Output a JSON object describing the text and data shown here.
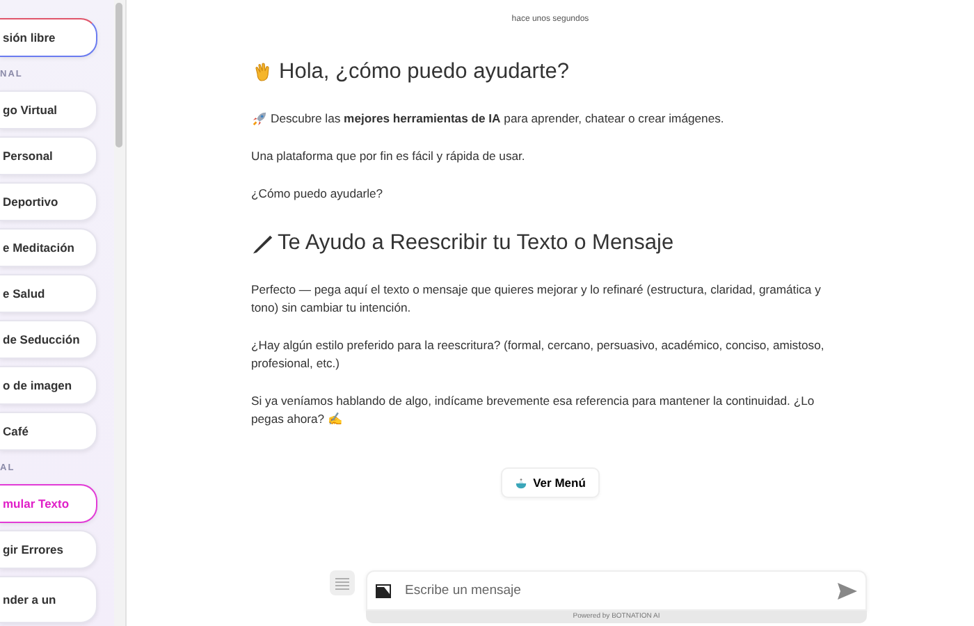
{
  "sidebar": {
    "items": [
      {
        "kind": "featured",
        "label": "sión libre",
        "selected": false
      },
      {
        "kind": "heading",
        "label": "NAL"
      },
      {
        "kind": "button",
        "label": "go Virtual",
        "selected": false
      },
      {
        "kind": "button",
        "label": "Personal",
        "selected": false
      },
      {
        "kind": "button",
        "label": "Deportivo",
        "selected": false
      },
      {
        "kind": "button",
        "label": "e Meditación",
        "selected": false
      },
      {
        "kind": "button",
        "label": "e Salud",
        "selected": false
      },
      {
        "kind": "button",
        "label": "de Seducción",
        "selected": false
      },
      {
        "kind": "button",
        "label": "o de imagen",
        "selected": false
      },
      {
        "kind": "button",
        "label": "Café",
        "selected": false
      },
      {
        "kind": "heading",
        "label": "AL"
      },
      {
        "kind": "button",
        "label": "mular Texto",
        "selected": true
      },
      {
        "kind": "button",
        "label": "gir Errores",
        "selected": false
      },
      {
        "kind": "button",
        "label": "nder a un",
        "selected": false
      }
    ]
  },
  "chat": {
    "timestamp": "hace unos segundos",
    "blocks": [
      {
        "kind": "heading",
        "text": "Hola, ¿cómo puedo ayudarte?"
      },
      {
        "kind": "paragraph",
        "text": "Descubre las **mejores herramientas de IA** para aprender, chatear o crear imágenes."
      },
      {
        "kind": "paragraph",
        "text": "Una plataforma que por fin es fácil y rápida de usar."
      },
      {
        "kind": "paragraph",
        "text": "¿Cómo puedo ayudarle?"
      },
      {
        "kind": "heading",
        "text": "Te Ayudo a Reescribir tu Texto o Mensaje"
      },
      {
        "kind": "paragraph",
        "text": "Perfecto — pega aquí el texto o mensaje que quieres mejorar y lo refinaré (estructura, claridad, gramática y tono) sin cambiar tu intención."
      },
      {
        "kind": "paragraph",
        "text": "¿Hay algún estilo preferido para la reescritura? (formal, cercano, persuasivo, académico, conciso, amistoso, profesional, etc.)"
      },
      {
        "kind": "paragraph",
        "text": "Si ya veníamos hablando de algo, indícame brevemente esa referencia para mantener la continuidad. ¿Lo pegas ahora? ✍"
      }
    ],
    "menu_button": "Ver Menú"
  },
  "composer": {
    "placeholder": "Escribe un mensaje",
    "powered_by": "Powered by BOTNATION AI"
  }
}
